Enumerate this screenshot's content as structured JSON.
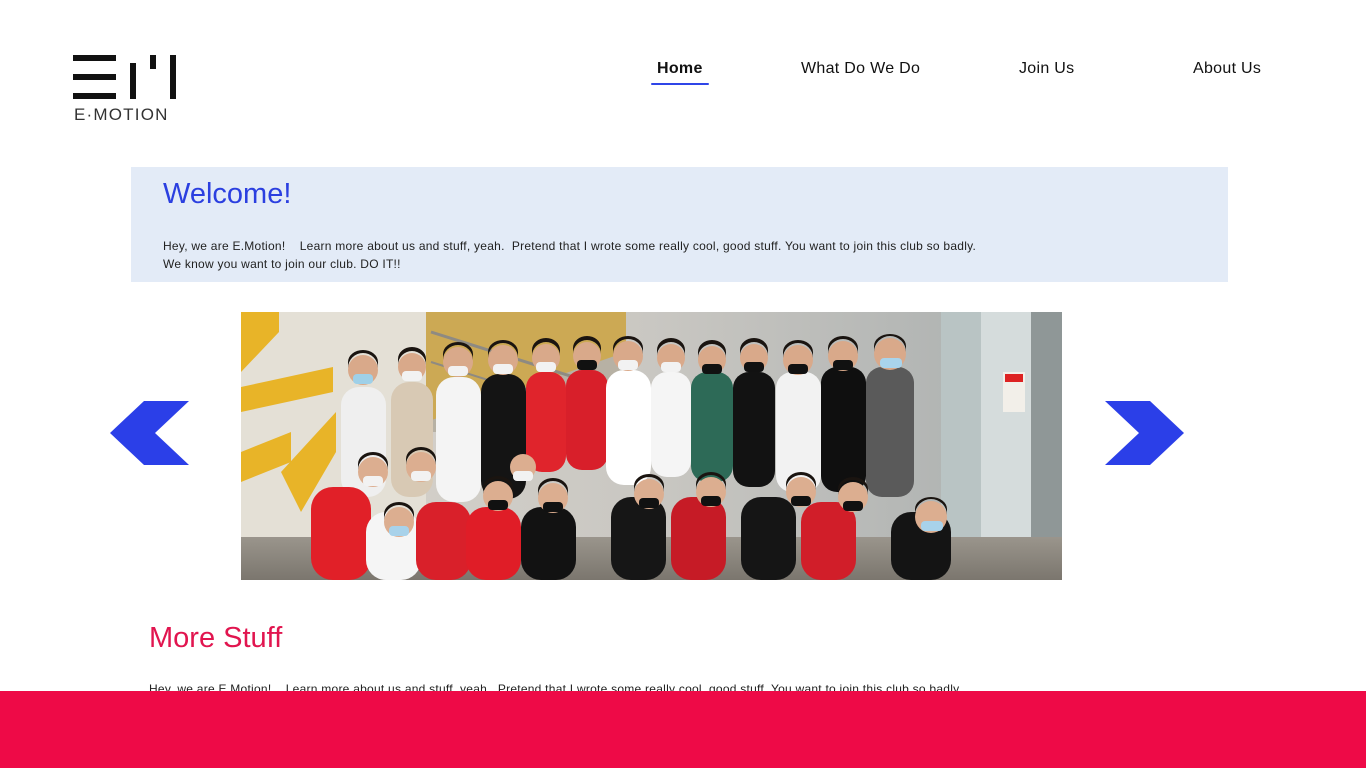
{
  "logo": {
    "text": "E·MOTION",
    "icon": "em-logo-mark"
  },
  "nav": {
    "items": [
      {
        "label": "Home",
        "active": true
      },
      {
        "label": "What Do We Do",
        "active": false
      },
      {
        "label": "Join Us",
        "active": false
      },
      {
        "label": "About Us",
        "active": false
      }
    ]
  },
  "welcome": {
    "title": "Welcome!",
    "line1": "Hey, we are E.Motion!    Learn more about us and stuff, yeah.  Pretend that I wrote some really cool, good stuff. You want to join this club so badly.",
    "line2": "We know you want to join our club. DO IT!!"
  },
  "carousel": {
    "prev_icon": "chevron-left-icon",
    "next_icon": "chevron-right-icon",
    "photo": "group-photo"
  },
  "more": {
    "title": "More Stuff",
    "text": "Hey, we are E.Motion!    Learn more about us and stuff, yeah.  Pretend that I wrote some really cool, good stuff. You want to join this club so badly."
  },
  "colors": {
    "accent_blue": "#2b3fe0",
    "welcome_bg": "#e3ebf7",
    "accent_red": "#ee0a47"
  }
}
